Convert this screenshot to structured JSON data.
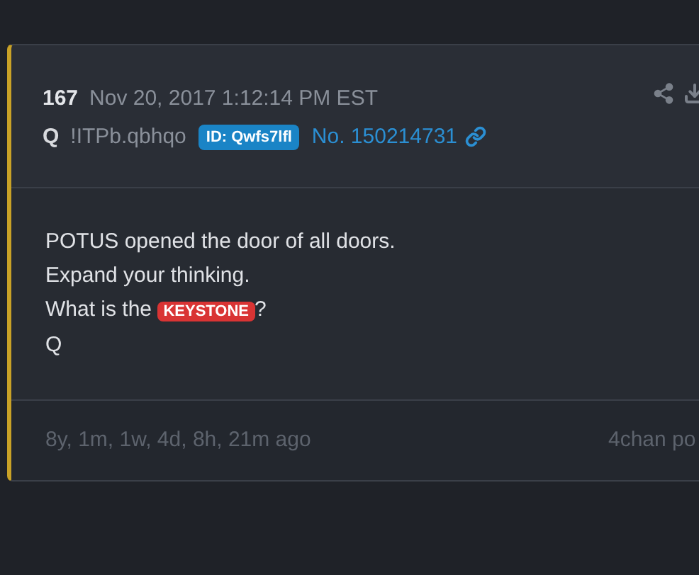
{
  "post": {
    "number": "167",
    "date": "Nov 20, 2017 1:12:14 PM EST",
    "author": "Q",
    "tripcode": "!ITPb.qbhqo",
    "id_badge": "ID: Qwfs7lfl",
    "post_no": "No. 150214731",
    "lines": [
      [
        {
          "kind": "text",
          "text": "POTUS opened the door of all doors."
        }
      ],
      [
        {
          "kind": "text",
          "text": "Expand your thinking."
        }
      ],
      [
        {
          "kind": "text",
          "text": "What is the "
        },
        {
          "kind": "highlight",
          "text": "KEYSTONE"
        },
        {
          "kind": "text",
          "text": "?"
        }
      ],
      [
        {
          "kind": "text",
          "text": "Q"
        }
      ]
    ],
    "age": "8y, 1m, 1w, 4d, 8h, 21m ago",
    "source": "4chan po"
  }
}
